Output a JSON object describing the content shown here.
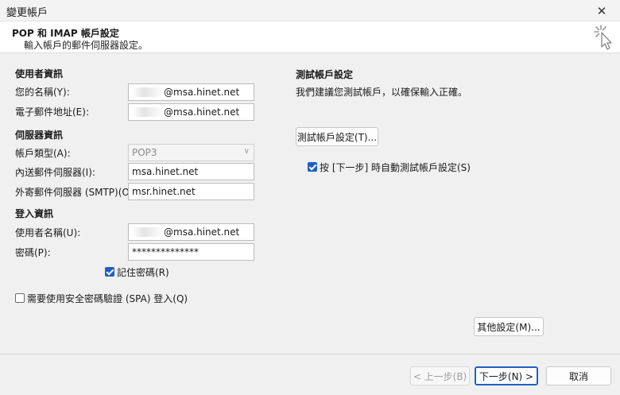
{
  "window": {
    "title": "變更帳戶",
    "close_glyph": "✕"
  },
  "header": {
    "title": "POP 和 IMAP 帳戶設定",
    "subtitle": "輸入帳戶的郵件伺服器設定。",
    "icon": "cursor-click-icon"
  },
  "user_info": {
    "section_title": "使用者資訊",
    "name_label": "您的名稱(Y):",
    "name_value": "@msa.hinet.net",
    "email_label": "電子郵件地址(E):",
    "email_value": "@msa.hinet.net"
  },
  "server_info": {
    "section_title": "伺服器資訊",
    "account_type_label": "帳戶類型(A):",
    "account_type_value": "POP3",
    "incoming_label": "內送郵件伺服器(I):",
    "incoming_value": "msa.hinet.net",
    "outgoing_label": "外寄郵件伺服器 (SMTP)(O):",
    "outgoing_value": "msr.hinet.net"
  },
  "login_info": {
    "section_title": "登入資訊",
    "username_label": "使用者名稱(U):",
    "username_value": "@msa.hinet.net",
    "password_label": "密碼(P):",
    "password_value": "**************",
    "remember_label": "記住密碼(R)",
    "spa_label": "需要使用安全密碼驗證 (SPA) 登入(Q)"
  },
  "test": {
    "section_title": "測試帳戶設定",
    "description": "我們建議您測試帳戶，以確保輸入正確。",
    "button_label": "測試帳戶設定(T)...",
    "auto_test_label": "按 [下一步] 時自動測試帳戶設定(S)"
  },
  "buttons": {
    "more_settings": "其他設定(M)...",
    "back": "< 上一步(B)",
    "next": "下一步(N) >",
    "cancel": "取消"
  },
  "colors": {
    "accent": "#1f5fc4",
    "background": "#f0f0f0",
    "header_bg": "#ffffff"
  }
}
